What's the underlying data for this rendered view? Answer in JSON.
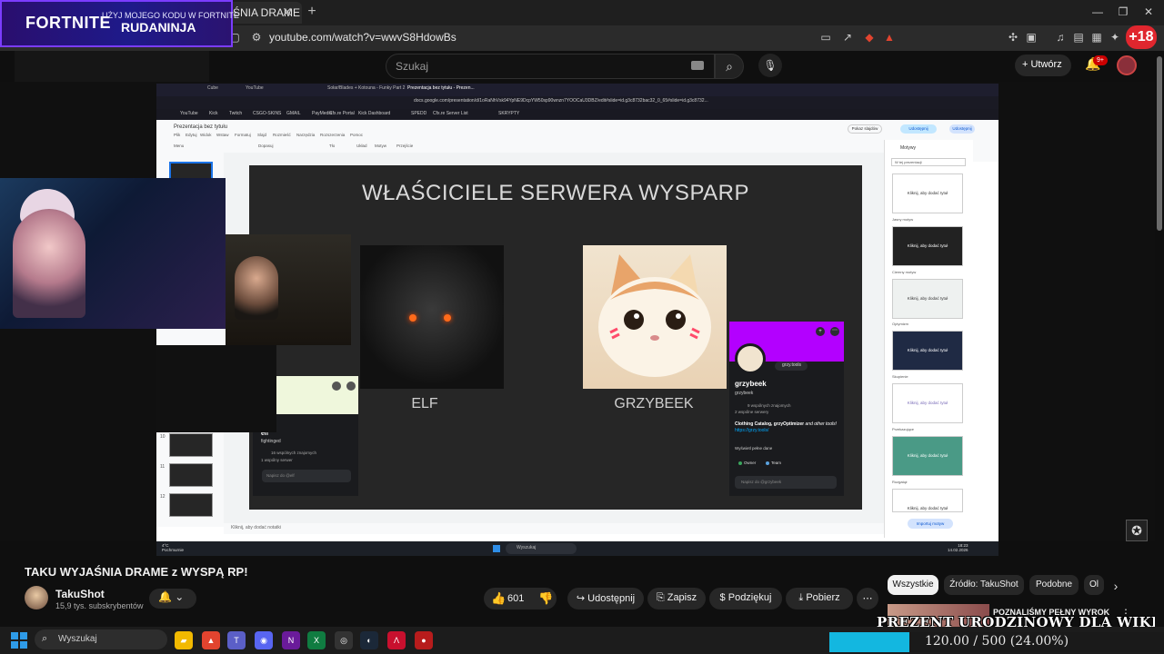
{
  "browser": {
    "tab_title": "ŚNIA DRAME",
    "url": "youtube.com/watch?v=wwvS8HdowBs",
    "new_tab": "+",
    "close": "✕",
    "plus18": "+18"
  },
  "fortnite_banner": {
    "logo": "FORTNITE",
    "line1": "UŻYJ MOJEGO KODU W FORTNITE",
    "code": "RUDANINJA"
  },
  "youtube_header": {
    "search_placeholder": "Szukaj",
    "create_label": "Utwórz",
    "notifications_badge": "9+"
  },
  "recorded_screen": {
    "tabs": [
      "Cube",
      "YouTube",
      "Sołar/Blades + Kotouna - Funky Part 2",
      "Prezentacja bez tytułu - Prezen..."
    ],
    "url": "docs.google.com/presentation/d/1oRaNhVsk94YpNE9DcpYW50sp90wnzn7YOOCaU3DBZ/edit#slide=id.g3c8732bac32_0_65#slide=id.g3c8732...",
    "bookmarks": [
      "YouTube",
      "Kick",
      "Twitch",
      "CSGO-SKINS",
      "GMAIL",
      "PayMedia",
      "Cfx.re Portal",
      "Kick Dashboard",
      "SPEDD",
      "Cfx.re Server List",
      "SKRYPTY"
    ],
    "slides_title": "Prezentacja bez tytułu",
    "menus": [
      "Plik",
      "Edytuj",
      "Widok",
      "Wstaw",
      "Formatuj",
      "Slajd",
      "Rozmieść",
      "Narzędzia",
      "Rozszerzenia",
      "Pomoc"
    ],
    "toolbar_items": [
      "Menu",
      "Dopasuj",
      "Tło",
      "Układ",
      "Motyw",
      "Przejście"
    ],
    "present_btn": "Pokaz slajdów",
    "share_btn": "Udostępnij",
    "publish_btn": "Udostępnij",
    "slide": {
      "title": "WŁAŚCICIELE SERWERA WYSPARP",
      "caption_left": "ELF",
      "caption_right": "GRZYBEEK"
    },
    "profile_grzybeek": {
      "pill": "grzy.tools",
      "name": "grzybeek",
      "username": "grzybeek",
      "mutual_friends": "9 wspólnych znajomych",
      "mutual_servers": "2 wspólne serwery",
      "bio_bold": "Clothing Catalog, grzyOptimizer",
      "bio_rest": " and other tools!",
      "link": "https://grzy.tools/",
      "view_full": "Wyświetl pełne dane",
      "role1": "Owner",
      "role2": "Team",
      "message_placeholder": "Napisz do @grzybeek"
    },
    "profile_elf": {
      "name": "elf",
      "username": "fightinged",
      "mutual_friends": "16 wspólnych znajomych",
      "mutual_servers": "1 wspólny serwer",
      "message_placeholder": "Napisz do @elf"
    },
    "filmstrip_numbers": [
      "10",
      "11",
      "12"
    ],
    "themes": {
      "title": "Motywy",
      "dropdown": "W tej prezentacji",
      "items": [
        {
          "label": "",
          "text": "Kliknij, aby dodać tytuł",
          "bg": "#ffffff",
          "fg": "#333333"
        },
        {
          "label": "Jasny motyw",
          "text": "Kliknij, aby dodać tytuł",
          "bg": "#222222",
          "fg": "#ffffff"
        },
        {
          "label": "Ciemny motyw",
          "text": "Kliknij, aby dodać tytuł",
          "bg": "#eef1f0",
          "fg": "#333333"
        },
        {
          "label": "Optymizm",
          "text": "Kliknij, aby dodać tytuł",
          "bg": "#1f2a44",
          "fg": "#ffffff"
        },
        {
          "label": "Skupienie",
          "text": "Kliknij, aby dodać tytuł",
          "bg": "#ffffff",
          "fg": "#7a6cb8"
        },
        {
          "label": "Przekazujące",
          "text": "Kliknij, aby dodać tytuł",
          "bg": "#4a9a86",
          "fg": "#ffffff"
        },
        {
          "label": "Rozgałąź",
          "text": "Kliknij, aby dodać tytuł",
          "bg": "#ffffff",
          "fg": "#333333"
        }
      ],
      "import_btn": "Importuj motyw"
    },
    "notes_placeholder": "Kliknij, aby dodać notatki",
    "taskbar_search": "Wyszukaj",
    "taskbar_temp": [
      "4°C",
      "Pochmurnie"
    ],
    "taskbar_time": [
      "18:23",
      "14.02.2026"
    ]
  },
  "video_info": {
    "title": "TAKU WYJAŚNIA DRAME z WYSPĄ RP!",
    "channel_name": "TakuShot",
    "subscribers": "15,9 tys. subskrybentów",
    "like_count": "601",
    "share_label": "Udostępnij",
    "save_label": "Zapisz",
    "thanks_label": "Podziękuj",
    "download_label": "Pobierz"
  },
  "chips": [
    "Wszystkie",
    "Źródło: TakuShot",
    "Podobne",
    "Ol"
  ],
  "recommended": {
    "title": "POZNALIŚMY PEŁNY WYROK"
  },
  "overlay": {
    "text": "PREZENT URODZINOWY DLA WIKI",
    "goal_text": "120.00 / 500 (24.00%)",
    "goal_fraction": 0.24
  },
  "windows_taskbar": {
    "search_placeholder": "Wyszukaj",
    "apps": [
      {
        "name": "explorer",
        "color": "#f2b900",
        "glyph": "▰"
      },
      {
        "name": "brave",
        "color": "#e2442f",
        "glyph": "▲"
      },
      {
        "name": "teams",
        "color": "#5b5fc7",
        "glyph": "T"
      },
      {
        "name": "discord",
        "color": "#5865f2",
        "glyph": "◉"
      },
      {
        "name": "kick-next",
        "color": "#6a1b9a",
        "glyph": "N"
      },
      {
        "name": "excel",
        "color": "#107c41",
        "glyph": "X"
      },
      {
        "name": "obs",
        "color": "#333333",
        "glyph": "◎"
      },
      {
        "name": "steam",
        "color": "#1b2838",
        "glyph": "◐"
      },
      {
        "name": "brave-red",
        "color": "#c8102e",
        "glyph": "Λ"
      },
      {
        "name": "record",
        "color": "#b71c1c",
        "glyph": "●"
      }
    ]
  },
  "colors": {
    "yt_bg": "#0f0f0f",
    "accent_red": "#e0262e",
    "discord_purple": "#b300ff",
    "goal_fill": "#13b7e0"
  }
}
